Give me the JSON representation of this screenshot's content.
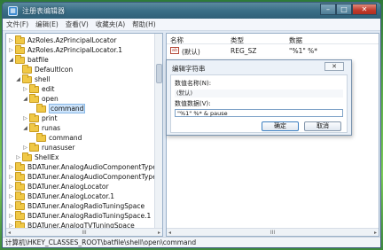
{
  "window": {
    "title": "注册表编辑器",
    "buttons": {
      "minimize": "–",
      "maximize": "□",
      "close": "✕"
    }
  },
  "menu": [
    "文件(F)",
    "编辑(E)",
    "查看(V)",
    "收藏夹(A)",
    "帮助(H)"
  ],
  "tree": [
    {
      "label": "AzRoles.AzPrincipalLocator",
      "expander": "▷"
    },
    {
      "label": "AzRoles.AzPrincipalLocator.1",
      "expander": "▷"
    },
    {
      "label": "batfile",
      "expander": "◢"
    },
    {
      "label": "DefaultIcon",
      "expander": ""
    },
    {
      "label": "shell",
      "expander": "◢"
    },
    {
      "label": "edit",
      "expander": "▷"
    },
    {
      "label": "open",
      "expander": "◢"
    },
    {
      "label": "command",
      "expander": ""
    },
    {
      "label": "print",
      "expander": "▷"
    },
    {
      "label": "runas",
      "expander": "◢"
    },
    {
      "label": "command",
      "expander": ""
    },
    {
      "label": "runasuser",
      "expander": "▷"
    },
    {
      "label": "ShellEx",
      "expander": "▷"
    },
    {
      "label": "BDATuner.AnalogAudioComponentType",
      "expander": "▷"
    },
    {
      "label": "BDATuner.AnalogAudioComponentType.1",
      "expander": "▷"
    },
    {
      "label": "BDATuner.AnalogLocator",
      "expander": "▷"
    },
    {
      "label": "BDATuner.AnalogLocator.1",
      "expander": "▷"
    },
    {
      "label": "BDATuner.AnalogRadioTuningSpace",
      "expander": "▷"
    },
    {
      "label": "BDATuner.AnalogRadioTuningSpace.1",
      "expander": "▷"
    },
    {
      "label": "BDATuner.AnalogTVTuningSpace",
      "expander": "▷"
    }
  ],
  "tree_scroll": {
    "left": "◂",
    "mid": "III",
    "right": "▸"
  },
  "list": {
    "headers": {
      "name": "名称",
      "type": "类型",
      "data": "数据"
    },
    "rows": [
      {
        "icon": "ab",
        "name": "(默认)",
        "type": "REG_SZ",
        "data": "\"%1\" %*"
      }
    ],
    "scroll": {
      "left": "◂",
      "mid": "III",
      "right": "▸"
    }
  },
  "dialog": {
    "title": "编辑字符串",
    "close_label": "✕",
    "name_label": "数值名称(N):",
    "name_value": "(默认)",
    "data_label": "数值数据(V):",
    "data_value": "\"%1\" %* & pause",
    "ok_label": "确定",
    "cancel_label": "取消"
  },
  "status": "计算机\\HKEY_CLASSES_ROOT\\batfile\\shell\\open\\command"
}
